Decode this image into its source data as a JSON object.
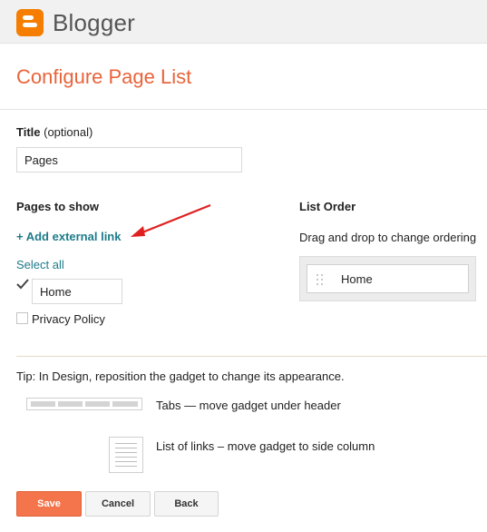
{
  "header": {
    "brand": "Blogger",
    "logo_icon": "blogger-logo-icon",
    "logo_color": "#f57d00"
  },
  "page": {
    "title": "Configure Page List",
    "title_color": "#e8643b"
  },
  "title_field": {
    "label": "Title",
    "optional": "(optional)",
    "value": "Pages"
  },
  "pages_to_show": {
    "heading": "Pages to show",
    "add_link": "+ Add external link",
    "select_all": "Select all",
    "items": [
      {
        "label": "Home",
        "checked": true,
        "editable": true
      },
      {
        "label": "Privacy Policy",
        "checked": false,
        "editable": false
      }
    ],
    "link_color": "#1e7b8a"
  },
  "list_order": {
    "heading": "List Order",
    "help": "Drag and drop to change ordering",
    "items": [
      {
        "label": "Home",
        "icon": "drag-handle-icon"
      }
    ]
  },
  "tips": {
    "tip": "Tip: In Design, reposition the gadget to change its appearance.",
    "tabs": "Tabs — move gadget under header",
    "list": "List of links – move gadget to side column"
  },
  "buttons": {
    "save": "Save",
    "cancel": "Cancel",
    "back": "Back",
    "save_color": "#f4744b"
  },
  "annotation": {
    "arrow_color": "#e02020"
  }
}
